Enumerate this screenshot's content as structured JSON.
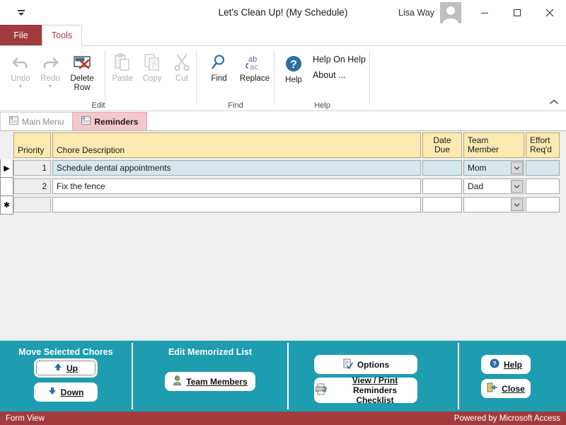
{
  "window": {
    "title": "Let's Clean Up! (My Schedule)",
    "username": "Lisa Way",
    "qat_icon": "quick-access-toolbar-dropdown-icon",
    "minimize_label": "–",
    "maximize_label": "□",
    "close_label": "✕"
  },
  "ribbon": {
    "tabs": [
      {
        "label": "File"
      },
      {
        "label": "Tools"
      }
    ],
    "collapse_label": "^",
    "groups": [
      {
        "name": "Edit",
        "label": "Edit",
        "buttons": [
          {
            "label": "Undo",
            "icon": "undo-arrow-icon",
            "disabled": true,
            "caret": "▾"
          },
          {
            "label": "Redo",
            "icon": "redo-arrow-icon",
            "disabled": true,
            "caret": "▾"
          },
          {
            "label": "Delete\nRow",
            "line1": "Delete",
            "line2": "Row",
            "icon": "delete-row-icon",
            "disabled": false
          },
          {
            "label": "Paste",
            "icon": "paste-icon",
            "disabled": true
          },
          {
            "label": "Copy",
            "icon": "copy-icon",
            "disabled": true
          },
          {
            "label": "Cut",
            "icon": "cut-scissors-icon",
            "disabled": true
          }
        ]
      },
      {
        "name": "Find",
        "label": "Find",
        "buttons": [
          {
            "label": "Find",
            "icon": "magnifier-icon",
            "disabled": false
          },
          {
            "label": "Replace",
            "icon": "replace-abac-icon",
            "disabled": false
          }
        ]
      },
      {
        "name": "Help",
        "label": "Help",
        "buttons": [
          {
            "label": "Help",
            "icon": "help-circle-icon",
            "disabled": false
          }
        ],
        "menu": [
          {
            "label": "Help On Help"
          },
          {
            "label": "About ..."
          }
        ]
      }
    ]
  },
  "doctabs": [
    {
      "label": "Main Menu",
      "icon": "form-icon",
      "active": false
    },
    {
      "label": "Reminders",
      "icon": "form-icon",
      "active": true
    }
  ],
  "datasheet": {
    "columns": [
      {
        "label": "Priority",
        "line1": "Priority",
        "line2": ""
      },
      {
        "label": "Chore Description",
        "line1": "Chore Description",
        "line2": ""
      },
      {
        "label": "Date Due",
        "line1": "Date",
        "line2": "Due"
      },
      {
        "label": "Team Member",
        "line1": "Team",
        "line2": "Member"
      },
      {
        "label": "Effort Req'd",
        "line1": "Effort",
        "line2": "Req'd"
      }
    ],
    "rows": [
      {
        "selector": "▶",
        "selected": true,
        "priority": "1",
        "chore": "Schedule dental appointments",
        "date_due": "",
        "team_member": "Mom",
        "effort": ""
      },
      {
        "selector": "",
        "selected": false,
        "priority": "2",
        "chore": "Fix the fence",
        "date_due": "",
        "team_member": "Dad",
        "effort": ""
      },
      {
        "selector": "✱",
        "selected": false,
        "new_record": true,
        "priority": "",
        "chore": "",
        "date_due": "",
        "team_member": "",
        "effort": ""
      }
    ]
  },
  "footer": {
    "sections": [
      {
        "label": "Move Selected Chores"
      },
      {
        "label": "Edit Memorized List"
      }
    ],
    "buttons": {
      "up": {
        "label": "Up",
        "accel": "U",
        "icon": "arrow-up-icon",
        "focused": true
      },
      "down": {
        "label": "Down",
        "accel": "D",
        "icon": "arrow-down-icon",
        "focused": false
      },
      "team_members": {
        "label": "Team Members",
        "accel": "T",
        "icon": "person-icon"
      },
      "options": {
        "label": "Options",
        "icon": "options-document-icon"
      },
      "view_print": {
        "line1": "View / Print",
        "line2": "Reminders Checklist",
        "accel": "V",
        "icon": "printer-icon"
      },
      "help": {
        "label": "Help",
        "accel": "H",
        "icon": "help-circle-icon"
      },
      "close": {
        "label": "Close",
        "accel": "C",
        "icon": "exit-door-icon"
      }
    }
  },
  "statusbar": {
    "left": "Form View",
    "right": "Powered by Microsoft Access"
  },
  "colors": {
    "accent_red": "#A23B3E",
    "teal": "#1E9CB0",
    "header_yellow": "#FBEBB2",
    "selected_row": "#D4E8EE",
    "tab_pink": "#F4C7CF"
  }
}
